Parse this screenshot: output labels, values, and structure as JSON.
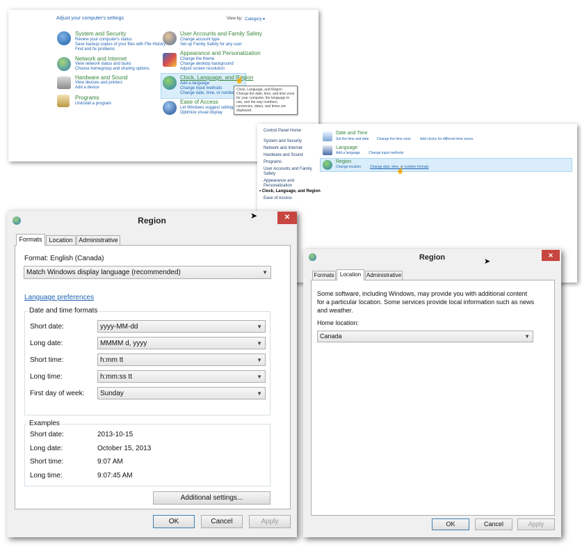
{
  "control_panel": {
    "heading": "Adjust your computer's settings",
    "view_by_label": "View by:",
    "view_by_value": "Category ▾",
    "categories": [
      {
        "title": "System and Security",
        "links": [
          "Review your computer's status",
          "Save backup copies of your files with File History",
          "Find and fix problems"
        ]
      },
      {
        "title": "Network and Internet",
        "links": [
          "View network status and tasks",
          "Choose homegroup and sharing options"
        ]
      },
      {
        "title": "Hardware and Sound",
        "links": [
          "View devices and printers",
          "Add a device"
        ]
      },
      {
        "title": "Programs",
        "links": [
          "Uninstall a program"
        ]
      },
      {
        "title": "User Accounts and Family Safety",
        "links": [
          "Change account type",
          "Set up Family Safety for any user"
        ]
      },
      {
        "title": "Appearance and Personalization",
        "links": [
          "Change the theme",
          "Change desktop background",
          "Adjust screen resolution"
        ]
      },
      {
        "title": "Clock, Language, and Region",
        "links": [
          "Add a language",
          "Change input methods",
          "Change date, time, or number formats"
        ]
      },
      {
        "title": "Ease of Access",
        "links": [
          "Let Windows suggest settings",
          "Optimize visual display"
        ]
      }
    ],
    "tooltip": [
      "Clock, Language, and Region",
      "Change the date, time, and time zone",
      "for your computer, the language to",
      "use, and the way numbers,",
      "currencies, dates, and times are",
      "displayed."
    ]
  },
  "clock_panel": {
    "sidebar": [
      "Control Panel Home",
      "System and Security",
      "Network and Internet",
      "Hardware and Sound",
      "Programs",
      "User Accounts and Family",
      "Safety",
      "Appearance and",
      "Personalization",
      "Clock, Language, and Region",
      "Ease of Access"
    ],
    "sections": [
      {
        "title": "Date and Time",
        "links": [
          "Set the time and date",
          "Change the time zone",
          "Add clocks for different time zones"
        ]
      },
      {
        "title": "Language",
        "links": [
          "Add a language",
          "Change input methods"
        ]
      },
      {
        "title": "Region",
        "links": [
          "Change location",
          "Change date, time, or number formats"
        ]
      }
    ]
  },
  "region_formats": {
    "title": "Region",
    "close": "✕",
    "tabs": [
      "Formats",
      "Location",
      "Administrative"
    ],
    "format_label": "Format: English (Canada)",
    "format_value": "Match Windows display language (recommended)",
    "language_link": "Language preferences",
    "dt_group": "Date and time formats",
    "fields": [
      {
        "label": "Short date:",
        "value": "yyyy-MM-dd"
      },
      {
        "label": "Long date:",
        "value": "MMMM d, yyyy"
      },
      {
        "label": "Short time:",
        "value": "h:mm tt"
      },
      {
        "label": "Long time:",
        "value": "h:mm:ss tt"
      },
      {
        "label": "First day of week:",
        "value": "Sunday"
      }
    ],
    "examples_group": "Examples",
    "examples": [
      {
        "label": "Short date:",
        "value": "2013-10-15"
      },
      {
        "label": "Long date:",
        "value": "October 15, 2013"
      },
      {
        "label": "Short time:",
        "value": "9:07 AM"
      },
      {
        "label": "Long time:",
        "value": "9:07:45 AM"
      }
    ],
    "additional": "Additional settings...",
    "ok": "OK",
    "cancel": "Cancel",
    "apply": "Apply"
  },
  "region_location": {
    "title": "Region",
    "close": "✕",
    "tabs": [
      "Formats",
      "Location",
      "Administrative"
    ],
    "desc1": "Some software, including Windows, may provide you with additional content",
    "desc2": "for a particular location. Some services provide local information such as news",
    "desc3": "and weather.",
    "home_label": "Home location:",
    "home_value": "Canada",
    "ok": "OK",
    "cancel": "Cancel",
    "apply": "Apply"
  },
  "colors": {
    "link": "#1e61b1",
    "category": "#36853a",
    "close": "#c7463f",
    "highlight": "#d9eefa"
  }
}
